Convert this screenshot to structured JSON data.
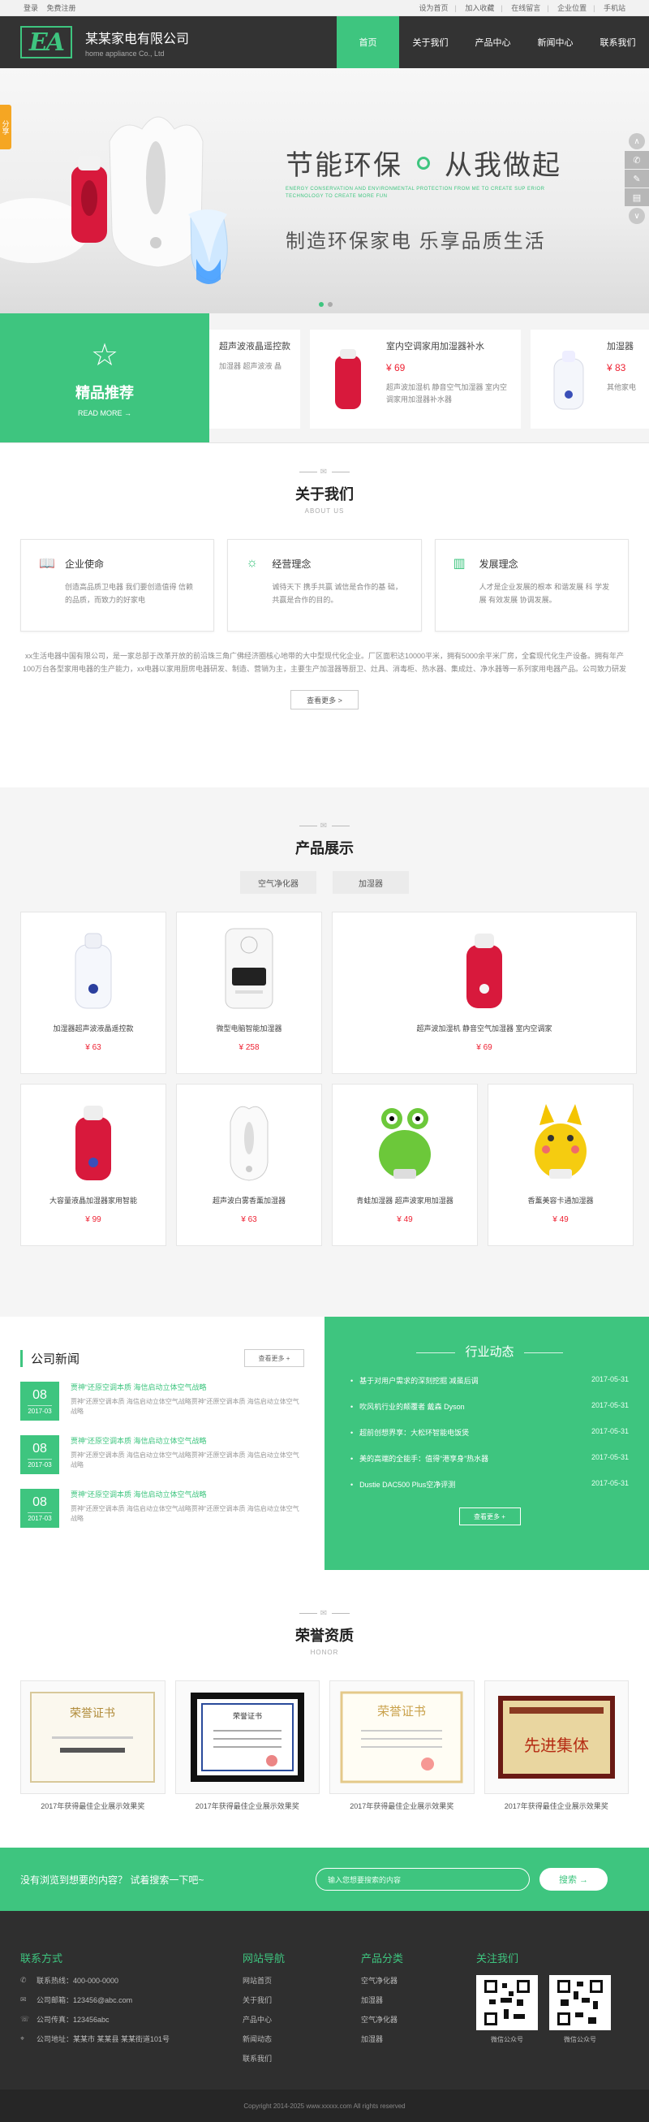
{
  "topbar": {
    "login": "登录",
    "register": "免费注册",
    "links": [
      "设为首页",
      "加入收藏",
      "在线留言",
      "企业位置",
      "手机站"
    ]
  },
  "header": {
    "logo_mark": "EA",
    "company_cn": "某某家电有限公司",
    "company_en": "home appliance Co., Ltd",
    "nav": [
      "首页",
      "关于我们",
      "产品中心",
      "新闻中心",
      "联系我们"
    ]
  },
  "banner": {
    "share_label": "分享",
    "headline_left": "节能环保",
    "headline_right": "从我做起",
    "tiny_text": "ENERGY CONSERVATION AND ENVIRONMENTAL PROTECTION FROM ME TO CREATE SUP ERIOR TECHNOLOGY TO CREATE MORE FUN",
    "slogan": "制造环保家电   乐享品质生活"
  },
  "featured": {
    "title": "精品推荐",
    "more": "READ MORE →",
    "items": [
      {
        "name": "超声波液晶遥控款",
        "price": "",
        "desc": "加湿器 超声波液 晶"
      },
      {
        "name": "室内空调家用加湿器补水",
        "price": "¥ 69",
        "desc": "超声波加湿机 静音空气加湿器 室内空调家用加湿器补水器"
      },
      {
        "name": "加湿器",
        "price": "¥ 83",
        "desc": "其他家电"
      }
    ]
  },
  "about": {
    "title": "关于我们",
    "en": "ABOUT US",
    "cards": [
      {
        "title": "企业使命",
        "text": "创造高品质卫电器 我们要创造值得 信赖的品质，而致力的好家电"
      },
      {
        "title": "经营理念",
        "text": "诚待天下 携手共赢 诚信是合作的基 础，共赢是合作的目的。"
      },
      {
        "title": "发展理念",
        "text": "人才是企业发展的根本 和谐发展 科 学发展 有效发展 协调发展。"
      }
    ],
    "paragraph": "xx生活电器中国有限公司，是一家总部于改革开放的前沿珠三角广佛经济圈核心地带的大中型现代化企业。厂区面积达10000平米，拥有5000余平米厂房，全套现代化生产设备。拥有年产100万台各型家用电器的生产能力，xx电器以家用厨房电器研发、制造、营销为主，主要生产加湿器等厨卫、灶具、消毒柜、热水器、集成灶、净水器等一系列家用电器产品。公司致力研发打破常规的产品，不断为消费者创造最新、最好的产品，真正做到产品人性化和实用性并提高消费者的生活品质。以“科技领先，不断创新”为宗旨，xx生活电器秉承自主研发的传统投入，拥有多名",
    "more": "查看更多 >"
  },
  "products": {
    "title": "产品展示",
    "en": "",
    "tabs": [
      "空气净化器",
      "加湿器"
    ],
    "items": [
      {
        "name": "加湿器超声波液晶遥控款",
        "price": "¥ 63"
      },
      {
        "name": "微型电脑智能加湿器",
        "price": "¥ 258"
      },
      {
        "name": "超声波加湿机 静音空气加湿器 室内空调家",
        "price": "¥ 69"
      },
      {
        "name": "大容量液晶加湿器家用智能",
        "price": "¥ 99"
      },
      {
        "name": "超声波白雾香薰加湿器",
        "price": "¥ 63"
      },
      {
        "name": "青蛙加湿器 超声波家用加湿器",
        "price": "¥ 49"
      },
      {
        "name": "香薰美容卡通加湿器",
        "price": "¥ 49"
      }
    ]
  },
  "news": {
    "title": "公司新闻",
    "more": "查看更多 +",
    "items": [
      {
        "day": "08",
        "ym": "2017-03",
        "title": "贾神“还原空调本质 海信启动立体空气战略",
        "summary": "贾神“还原空调本质 海信启动立体空气战略贾神“还原空调本质 海信启动立体空气战略"
      },
      {
        "day": "08",
        "ym": "2017-03",
        "title": "贾神“还原空调本质 海信启动立体空气战略",
        "summary": "贾神“还原空调本质 海信启动立体空气战略贾神“还原空调本质 海信启动立体空气战略"
      },
      {
        "day": "08",
        "ym": "2017-03",
        "title": "贾神“还原空调本质 海信启动立体空气战略",
        "summary": "贾神“还原空调本质 海信启动立体空气战略贾神“还原空调本质 海信启动立体空气战略"
      }
    ],
    "industry_title": "行业动态",
    "industry": [
      {
        "title": "基于对用户需求的深刻挖掘 减虽后调",
        "date": "2017-05-31"
      },
      {
        "title": "吹风机行业的颠覆者 戴森 Dyson",
        "date": "2017-05-31"
      },
      {
        "title": "超前创想界享：大松环智能电饭煲",
        "date": "2017-05-31"
      },
      {
        "title": "美的高端的全能手：值得“港享身”热水器",
        "date": "2017-05-31"
      },
      {
        "title": "Dustie DAC500 Plus空净评测",
        "date": "2017-05-31"
      }
    ],
    "industry_more": "查看更多 +"
  },
  "honor": {
    "title": "荣誉资质",
    "en": "HONOR",
    "items": [
      {
        "caption": "2017年获得最佳企业展示效果奖",
        "cert": "荣誉证书"
      },
      {
        "caption": "2017年获得最佳企业展示效果奖",
        "cert": "荣誉证书"
      },
      {
        "caption": "2017年获得最佳企业展示效果奖",
        "cert": "荣誉证书"
      },
      {
        "caption": "2017年获得最佳企业展示效果奖",
        "cert": "先进集体"
      }
    ]
  },
  "search": {
    "question": "没有浏览到想要的内容？ 试着搜索一下吧~",
    "placeholder": "输入您想要搜索的内容",
    "button": "搜索 →"
  },
  "footer": {
    "contact_title": "联系方式",
    "contact": [
      "联系热线：400-000-0000",
      "公司邮箱：123456@abc.com",
      "公司传真：123456abc",
      "公司地址：某某市 某某县 某某街道101号"
    ],
    "nav_title": "网站导航",
    "nav": [
      "网站首页",
      "关于我们",
      "产品中心",
      "新闻动态",
      "联系我们"
    ],
    "cat_title": "产品分类",
    "cats": [
      "空气净化器",
      "加湿器",
      "空气净化器",
      "加湿器"
    ],
    "follow_title": "关注我们",
    "qr": [
      "微信公众号",
      "微信公众号"
    ],
    "copyright": "Copyright 2014-2025 www.xxxxx.com All rights reserved"
  },
  "colors": {
    "accent": "#3ec57f",
    "header": "#333333",
    "price": "#e22233"
  }
}
